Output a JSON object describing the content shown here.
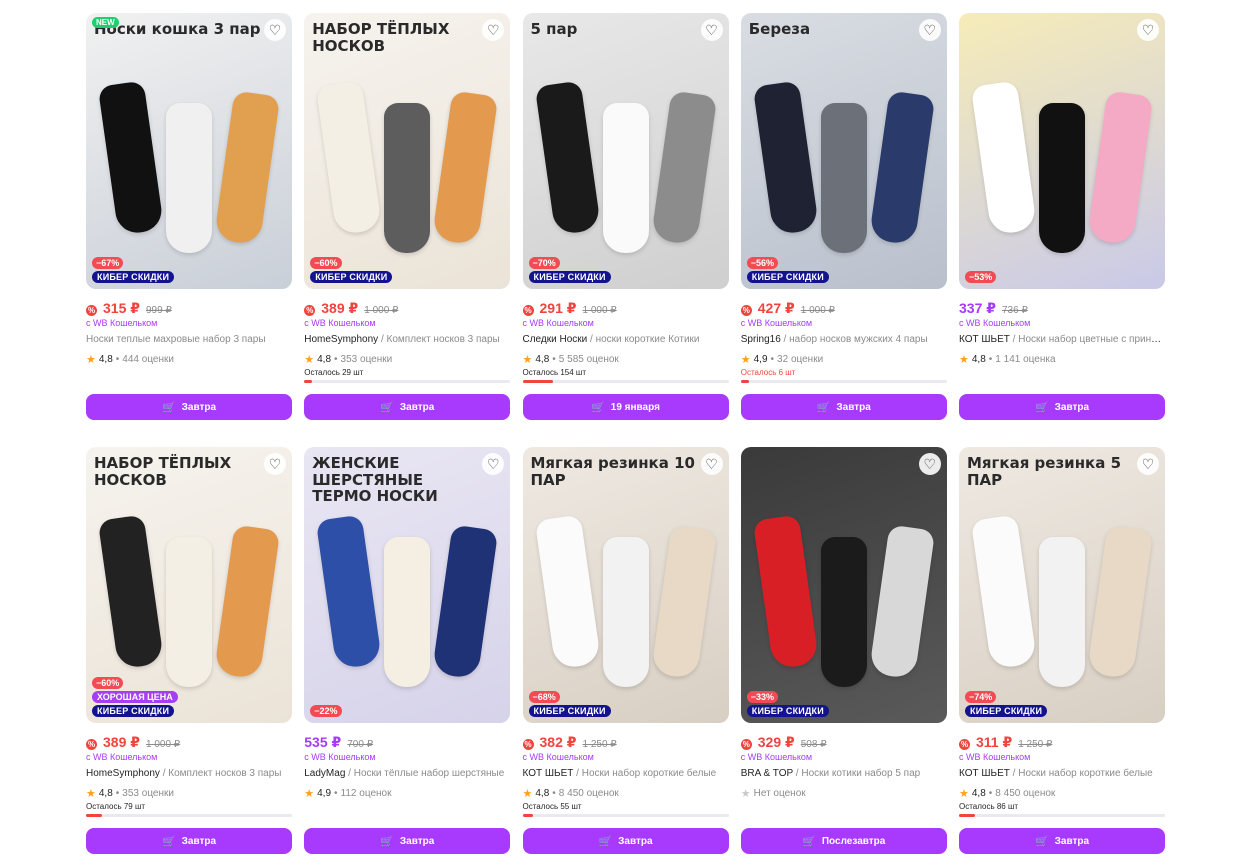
{
  "products": [
    {
      "caption": "Носки кошка 3 пар",
      "is_new": true,
      "new_label": "NEW",
      "discount": "−67%",
      "good_price": "",
      "cyber": "КИБЕР СКИДКИ",
      "price": "315 ₽",
      "old_price": "999 ₽",
      "wallet": "с WB Кошельком",
      "brand": "",
      "name": "Носки теплые махровые набор 3 пары",
      "rating": "4,8",
      "reviews": "444 оценки",
      "stock": "",
      "stock_fraction": 0,
      "stock_urgent": false,
      "button": "Завтра",
      "price_color": "red",
      "bg": [
        "#f1f1f1",
        "#c9cfd8"
      ],
      "socks": [
        "#111111",
        "#f0f0f0",
        "#e0a050"
      ]
    },
    {
      "caption": "НАБОР ТЁПЛЫХ НОСКОВ",
      "is_new": false,
      "new_label": "",
      "discount": "−60%",
      "good_price": "",
      "cyber": "КИБЕР СКИДКИ",
      "price": "389 ₽",
      "old_price": "1 000 ₽",
      "wallet": "с WB Кошельком",
      "brand": "HomeSymphony",
      "name": "Комплект носков 3 пары",
      "rating": "4,8",
      "reviews": "353 оценки",
      "stock": "Осталось 29 шт",
      "stock_fraction": 0.03,
      "stock_urgent": false,
      "button": "Завтра",
      "price_color": "red",
      "bg": [
        "#f6f3ee",
        "#ebe3d7"
      ],
      "socks": [
        "#f3efe4",
        "#5d5d5d",
        "#e39a4f"
      ]
    },
    {
      "caption": "5 пар",
      "is_new": false,
      "new_label": "",
      "discount": "−70%",
      "good_price": "",
      "cyber": "КИБЕР СКИДКИ",
      "price": "291 ₽",
      "old_price": "1 000 ₽",
      "wallet": "с WB Кошельком",
      "brand": "Следки Носки",
      "name": "носки короткие Котики",
      "rating": "4,8",
      "reviews": "5 585 оценок",
      "stock": "Осталось 154 шт",
      "stock_fraction": 0.15,
      "stock_urgent": false,
      "button": "19 января",
      "price_color": "red",
      "bg": [
        "#e8e8e8",
        "#cfcfcf"
      ],
      "socks": [
        "#1a1a1a",
        "#fafafa",
        "#8c8c8c"
      ]
    },
    {
      "caption": "Береза",
      "is_new": false,
      "new_label": "",
      "discount": "−56%",
      "good_price": "",
      "cyber": "КИБЕР СКИДКИ",
      "price": "427 ₽",
      "old_price": "1 000 ₽",
      "wallet": "с WB Кошельком",
      "brand": "Spring16",
      "name": "набор носков мужских 4 пары",
      "rating": "4,9",
      "reviews": "32 оценки",
      "stock": "Осталось 6 шт",
      "stock_fraction": 0.01,
      "stock_urgent": true,
      "button": "Завтра",
      "price_color": "red",
      "bg": [
        "#d9dde3",
        "#b9c0cc"
      ],
      "socks": [
        "#1e2233",
        "#6c7079",
        "#2a3a6a"
      ]
    },
    {
      "caption": "",
      "is_new": false,
      "new_label": "",
      "discount": "−53%",
      "good_price": "",
      "cyber": "",
      "price": "337 ₽",
      "old_price": "736 ₽",
      "wallet": "с WB Кошельком",
      "brand": "КОТ ШЬЕТ",
      "name": "Носки набор цветные с принтом",
      "rating": "4,8",
      "reviews": "1 141 оценка",
      "stock": "",
      "stock_fraction": 0,
      "stock_urgent": false,
      "button": "Завтра",
      "price_color": "purple",
      "bg": [
        "#f6ecb8",
        "#c9c9e8"
      ],
      "socks": [
        "#ffffff",
        "#111111",
        "#f4a9c5"
      ]
    },
    {
      "caption": "НАБОР ТЁПЛЫХ НОСКОВ",
      "is_new": false,
      "new_label": "",
      "discount": "−60%",
      "good_price": "ХОРОШАЯ ЦЕНА",
      "cyber": "КИБЕР СКИДКИ",
      "price": "389 ₽",
      "old_price": "1 000 ₽",
      "wallet": "с WB Кошельком",
      "brand": "HomeSymphony",
      "name": "Комплект носков 3 пары",
      "rating": "4,8",
      "reviews": "353 оценки",
      "stock": "Осталось 79 шт",
      "stock_fraction": 0.08,
      "stock_urgent": false,
      "button": "Завтра",
      "price_color": "red",
      "bg": [
        "#f6f3ee",
        "#ebe3d7"
      ],
      "socks": [
        "#222222",
        "#f3efe4",
        "#e39a4f"
      ]
    },
    {
      "caption": "ЖЕНСКИЕ ШЕРСТЯНЫЕ ТЕРМО НОСКИ",
      "is_new": false,
      "new_label": "",
      "discount": "−22%",
      "good_price": "",
      "cyber": "",
      "price": "535 ₽",
      "old_price": "700 ₽",
      "wallet": "с WB Кошельком",
      "brand": "LadyMag",
      "name": "Носки тёплые набор шерстяные",
      "rating": "4,9",
      "reviews": "112 оценок",
      "stock": "",
      "stock_fraction": 0,
      "stock_urgent": false,
      "button": "Завтра",
      "price_color": "purple",
      "bg": [
        "#e9e6f3",
        "#d6d3ea"
      ],
      "socks": [
        "#2e4fa8",
        "#f4efe2",
        "#1f3276"
      ]
    },
    {
      "caption": "Мягкая резинка 10 ПАР",
      "is_new": false,
      "new_label": "",
      "discount": "−68%",
      "good_price": "",
      "cyber": "КИБЕР СКИДКИ",
      "price": "382 ₽",
      "old_price": "1 250 ₽",
      "wallet": "с WB Кошельком",
      "brand": "КОТ ШЬЕТ",
      "name": "Носки набор короткие белые",
      "rating": "4,8",
      "reviews": "8 450 оценок",
      "stock": "Осталось 55 шт",
      "stock_fraction": 0.05,
      "stock_urgent": false,
      "button": "Завтра",
      "price_color": "red",
      "bg": [
        "#efe9e2",
        "#d8cfc3"
      ],
      "socks": [
        "#fbfbfb",
        "#f2f2f2",
        "#e8d9c6"
      ]
    },
    {
      "caption": "",
      "is_new": false,
      "new_label": "",
      "discount": "−33%",
      "good_price": "",
      "cyber": "КИБЕР СКИДКИ",
      "price": "329 ₽",
      "old_price": "508 ₽",
      "wallet": "с WB Кошельком",
      "brand": "BRA & TOP",
      "name": "Носки котики набор 5 пар",
      "rating": "",
      "reviews": "Нет оценок",
      "stock": "",
      "stock_fraction": 0,
      "stock_urgent": false,
      "button": "Послезавтра",
      "price_color": "red",
      "bg": [
        "#3a3a3a",
        "#5a5a5a"
      ],
      "socks": [
        "#d81f26",
        "#1b1b1b",
        "#d8d8d8"
      ]
    },
    {
      "caption": "Мягкая резинка 5 ПАР",
      "is_new": false,
      "new_label": "",
      "discount": "−74%",
      "good_price": "",
      "cyber": "КИБЕР СКИДКИ",
      "price": "311 ₽",
      "old_price": "1 250 ₽",
      "wallet": "с WB Кошельком",
      "brand": "КОТ ШЬЕТ",
      "name": "Носки набор короткие белые",
      "rating": "4,8",
      "reviews": "8 450 оценок",
      "stock": "Осталось 86 шт",
      "stock_fraction": 0.08,
      "stock_urgent": false,
      "button": "Завтра",
      "price_color": "red",
      "bg": [
        "#efe9e2",
        "#d8cfc3"
      ],
      "socks": [
        "#fbfbfb",
        "#f2f2f2",
        "#e8d9c6"
      ]
    }
  ],
  "icons": {
    "favorite": "heart-outline-icon",
    "cart": "cart-icon",
    "star": "star-icon",
    "wallet": "wb-wallet-icon"
  },
  "colors": {
    "accent": "#a73afd",
    "price": "#f0443f",
    "cyber": "#14138f",
    "new": "#1fcf6d"
  }
}
